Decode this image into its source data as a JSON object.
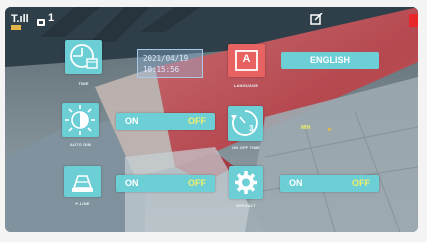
{
  "status_bar": {
    "signal_text": "T.ıll",
    "camera_number": "1",
    "edit_icon": "edit-icon",
    "recording_indicator_color": "#e8262a"
  },
  "time": {
    "caption": "TIME",
    "date": "2021/04/19",
    "clock": "10:15:56",
    "icon": "clock-calendar-icon"
  },
  "language": {
    "caption": "LANGUAGE",
    "icon_letter": "A",
    "value": "ENGLISH"
  },
  "auto_dim": {
    "caption": "AUTO DIM",
    "icon": "brightness-icon",
    "on_label": "ON",
    "off_label": "OFF"
  },
  "timer": {
    "caption": "ON OFF TIME",
    "icon": "timer-icon",
    "icon_number": "3",
    "value": "MIN"
  },
  "p_line": {
    "caption": "P-LINE",
    "icon": "parking-line-icon",
    "on_label": "ON",
    "off_label": "OFF"
  },
  "default": {
    "caption": "DEFAULT",
    "icon": "gear-icon",
    "on_label": "ON",
    "off_label": "OFF"
  },
  "colors": {
    "tile": "#6dcfd6",
    "language_tile": "#e86262",
    "off_text": "#f1ee6a",
    "on_text": "#ffffff"
  }
}
